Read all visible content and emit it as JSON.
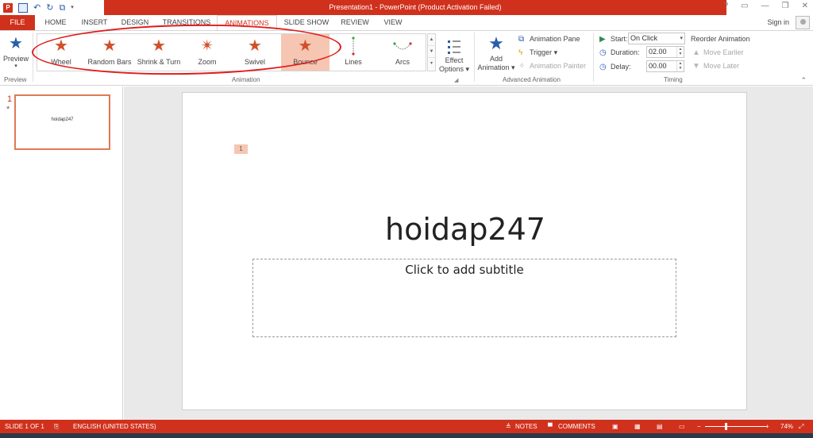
{
  "window": {
    "title": "Presentation1 - PowerPoint (Product Activation Failed)",
    "help": "?",
    "controls": [
      "▭",
      "—",
      "❐",
      "✕"
    ]
  },
  "tabs": {
    "file": "FILE",
    "home": "HOME",
    "insert": "INSERT",
    "design": "DESIGN",
    "transitions": "TRANSITIONS",
    "animations": "ANIMATIONS",
    "slideshow": "SLIDE SHOW",
    "review": "REVIEW",
    "view": "VIEW",
    "signin": "Sign in"
  },
  "ribbon": {
    "preview": {
      "label": "Preview",
      "arrow": "▾",
      "group": "Preview"
    },
    "gallery": {
      "items": [
        "Wheel",
        "Random Bars",
        "Shrink & Turn",
        "Zoom",
        "Swivel",
        "Bounce",
        "Lines",
        "Arcs"
      ],
      "selected": "Bounce",
      "group": "Animation"
    },
    "effect_options": {
      "line1": "Effect",
      "line2": "Options ▾"
    },
    "advanced": {
      "add_line1": "Add",
      "add_line2": "Animation ▾",
      "animation_pane": "Animation Pane",
      "trigger": "Trigger ▾",
      "animation_painter": "Animation Painter",
      "group": "Advanced Animation"
    },
    "timing": {
      "start_label": "Start:",
      "start_value": "On Click",
      "duration_label": "Duration:",
      "duration_value": "02.00",
      "delay_label": "Delay:",
      "delay_value": "00.00",
      "reorder": "Reorder Animation",
      "move_earlier": "Move Earlier",
      "move_later": "Move Later",
      "group": "Timing"
    }
  },
  "thumbnails": [
    {
      "number": "1",
      "marker": "*",
      "text": "hoidap247"
    }
  ],
  "slide": {
    "anim_tag": "1",
    "title": "hoidap247",
    "subtitle_placeholder": "Click to add subtitle"
  },
  "status": {
    "slide": "SLIDE 1 OF 1",
    "language": "ENGLISH (UNITED STATES)",
    "notes": "NOTES",
    "comments": "COMMENTS",
    "zoom_minus": "−",
    "zoom_plus": "+",
    "zoom": "74%",
    "zoom_level": 0.74
  }
}
